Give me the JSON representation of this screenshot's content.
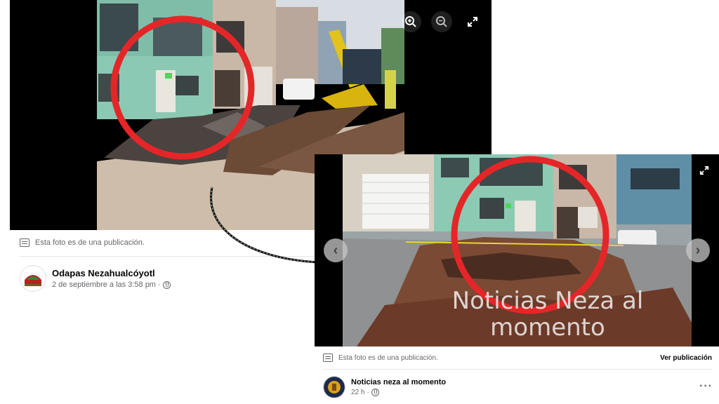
{
  "post1": {
    "info_text": "Esta foto es de una publicación.",
    "author": {
      "name": "Odapas Nezahualcóyotl",
      "date": "2 de septiembre a las 3:58 pm",
      "separator": "·"
    },
    "viewer_controls": [
      "zoom-in-icon",
      "zoom-out-icon",
      "fullscreen-icon"
    ]
  },
  "post2": {
    "info_text": "Esta foto es de una publicación.",
    "see_post_label": "Ver publicación",
    "watermark": "Noticias Neza al momento",
    "author": {
      "name": "Noticias neza al momento",
      "date": "22 h",
      "separator": "·"
    },
    "more_label": "···",
    "nav": {
      "prev_icon": "chevron-left-icon",
      "next_icon": "chevron-right-icon"
    }
  },
  "colors": {
    "annotation_circle": "#e52628",
    "viewer_background": "#000000",
    "secondary_text": "#65676b"
  }
}
